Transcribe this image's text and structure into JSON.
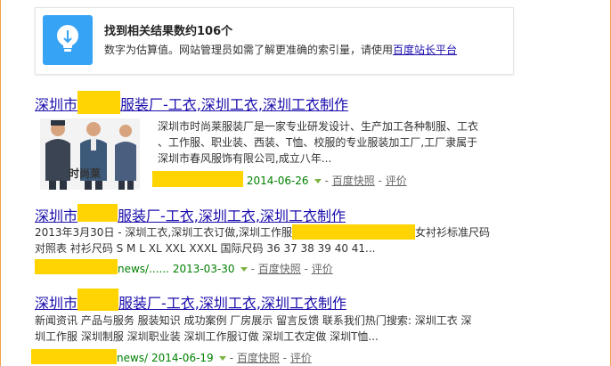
{
  "tip": {
    "title": "找到相关结果数约106个",
    "text": "数字为估算值。网站管理员如需了解更准确的索引量，请使用",
    "link": "百度站长平台",
    "icon": "lightbulb-icon",
    "icon_color": "#36a3f4"
  },
  "results": [
    {
      "title_prefix": "深圳市",
      "title_suffix": "服装厂-工衣,深圳工衣,深圳工衣制作",
      "snippet": [
        "深圳市时尚莱服装厂是一家专业研发设计、生产加工各种制服、工衣",
        "、工作服、职业装、西装、T恤、校服的专业服装加工厂,工厂隶属于",
        "深圳市春风服饰有限公司,成立八年..."
      ],
      "image_label": "时尚莱",
      "date": "2014-06-26",
      "cache": "百度快照",
      "review": "评价"
    },
    {
      "title_prefix": "深圳市",
      "title_suffix": "服装厂-工衣,深圳工衣,深圳工衣制作",
      "snippet_line1_a": "2013年3月30日 - 深圳工衣,深圳工衣订做,深圳工作服",
      "snippet_line1_b": "女衬衫标准尺码",
      "snippet_line2": "对照表 衬衫尺码 S M L XL XXL XXXL 国际尺码 36 37 38 39 40 41...",
      "url_tail": "news/......",
      "date": "2013-03-30",
      "cache": "百度快照",
      "review": "评价"
    },
    {
      "title_prefix": "深圳市",
      "title_suffix": "服装厂-工衣,深圳工衣,深圳工衣制作",
      "snippet": [
        "新闻资讯 产品与服务 服装知识 成功案例 厂房展示 留言反馈 联系我们热门搜索: 深圳工衣 深",
        "圳工作服 深圳制服 深圳职业装 深圳工作服订做 深圳工衣定做 深圳T恤..."
      ],
      "url_tail": "news/",
      "date": "2014-06-19",
      "cache": "百度快照",
      "review": "评价"
    }
  ],
  "colors": {
    "link": "#1a0dab",
    "url": "#008000",
    "redaction": "#ffd400"
  }
}
